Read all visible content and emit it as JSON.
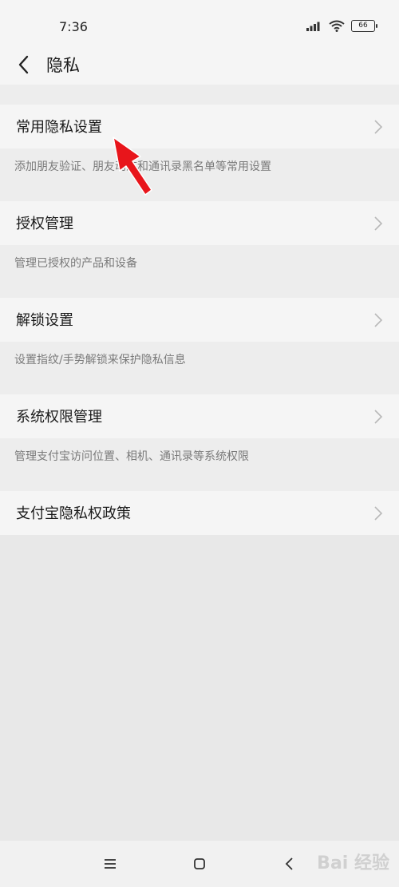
{
  "status_bar": {
    "time": "7:36",
    "battery": "66"
  },
  "header": {
    "title": "隐私"
  },
  "sections": [
    {
      "title": "常用隐私设置",
      "description": "添加朋友验证、朋友动态和通讯录黑名单等常用设置"
    },
    {
      "title": "授权管理",
      "description": "管理已授权的产品和设备"
    },
    {
      "title": "解锁设置",
      "description": "设置指纹/手势解锁来保护隐私信息"
    },
    {
      "title": "系统权限管理",
      "description": "管理支付宝访问位置、相机、通讯录等系统权限"
    },
    {
      "title": "支付宝隐私权政策"
    }
  ],
  "watermark": "Bai 经验",
  "colors": {
    "annotation_arrow": "#e8151b"
  }
}
